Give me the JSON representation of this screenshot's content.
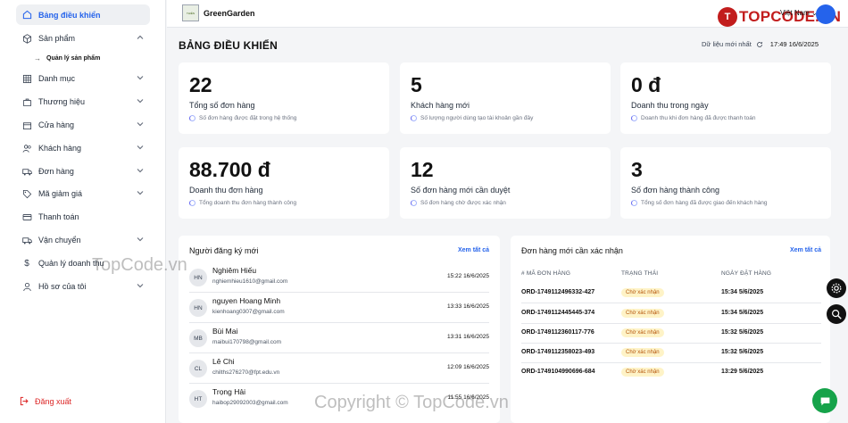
{
  "sidebar": {
    "items": [
      {
        "label": "Bảng điều khiển",
        "icon": "home-icon"
      },
      {
        "label": "Sản phẩm",
        "icon": "box-icon"
      },
      {
        "label": "Danh mục",
        "icon": "grid-icon"
      },
      {
        "label": "Thương hiệu",
        "icon": "briefcase-icon"
      },
      {
        "label": "Cửa hàng",
        "icon": "store-icon"
      },
      {
        "label": "Khách hàng",
        "icon": "users-icon"
      },
      {
        "label": "Đơn hàng",
        "icon": "truck-icon"
      },
      {
        "label": "Mã giảm giá",
        "icon": "tag-icon"
      },
      {
        "label": "Thanh toán",
        "icon": "card-icon"
      },
      {
        "label": "Vận chuyển",
        "icon": "shipping-icon"
      },
      {
        "label": "Quản lý doanh thu",
        "icon": "dollar-icon"
      },
      {
        "label": "Hồ sơ của tôi",
        "icon": "user-icon"
      }
    ],
    "subitem": "Quản lý sản phẩm",
    "logout": "Đăng xuất"
  },
  "topbar": {
    "brand": "GreenGarden",
    "brand_logo_text": "THIÊN",
    "watermark_logo": "TOPCODE.VN",
    "language": "Việt Nam"
  },
  "header": {
    "title": "BẢNG ĐIỀU KHIỂN",
    "refresh_label": "Dữ liệu mới nhất",
    "timestamp": "17:49 16/6/2025"
  },
  "stats": [
    {
      "value": "22",
      "label": "Tổng số đơn hàng",
      "desc": "Số đơn hàng được đặt trong hệ thống"
    },
    {
      "value": "5",
      "label": "Khách hàng mới",
      "desc": "Số lượng người dùng tạo tài khoản gần đây"
    },
    {
      "value": "0 đ",
      "label": "Doanh thu trong ngày",
      "desc": "Doanh thu khi đơn hàng đã được thanh toán"
    },
    {
      "value": "88.700 đ",
      "label": "Doanh thu đơn hàng",
      "desc": "Tổng doanh thu đơn hàng thành công"
    },
    {
      "value": "12",
      "label": "Số đơn hàng mới cần duyệt",
      "desc": "Số đơn hàng chờ được xác nhận"
    },
    {
      "value": "3",
      "label": "Số đơn hàng thành công",
      "desc": "Tổng số đơn hàng đã được giao đến khách hàng"
    }
  ],
  "new_users": {
    "title": "Người đăng ký mới",
    "see_all": "Xem tất cả",
    "rows": [
      {
        "initials": "HN",
        "name": "Nghiêm Hiếu",
        "email": "nghiemhieu1610@gmail.com",
        "time": "15:22 16/6/2025"
      },
      {
        "initials": "HN",
        "name": "nguyen Hoang Minh",
        "email": "kienhoang0307@gmail.com",
        "time": "13:33 16/6/2025"
      },
      {
        "initials": "MB",
        "name": "Bùi Mai",
        "email": "maibui170798@gmail.com",
        "time": "13:31 16/6/2025"
      },
      {
        "initials": "CL",
        "name": "Lê Chi",
        "email": "chilths276270@fpt.edu.vn",
        "time": "12:09 16/6/2025"
      },
      {
        "initials": "HT",
        "name": "Trọng Hải",
        "email": "haibop29092003@gmail.com",
        "time": "11:55 16/6/2025"
      }
    ]
  },
  "new_orders": {
    "title": "Đơn hàng mới cần xác nhận",
    "see_all": "Xem tất cả",
    "headers": [
      "# MÃ ĐƠN HÀNG",
      "TRẠNG THÁI",
      "NGÀY ĐẶT HÀNG"
    ],
    "rows": [
      {
        "code": "ORD-1749112496332-427",
        "status": "Chờ xác nhận",
        "date": "15:34 5/6/2025"
      },
      {
        "code": "ORD-1749112445445-374",
        "status": "Chờ xác nhận",
        "date": "15:34 5/6/2025"
      },
      {
        "code": "ORD-1749112360117-776",
        "status": "Chờ xác nhận",
        "date": "15:32 5/6/2025"
      },
      {
        "code": "ORD-1749112358023-493",
        "status": "Chờ xác nhận",
        "date": "15:32 5/6/2025"
      },
      {
        "code": "ORD-1749104990696-684",
        "status": "Chờ xác nhận",
        "date": "13:29 5/6/2025"
      }
    ]
  },
  "watermarks": {
    "mid": "TopCode.vn",
    "bottom": "Copyright © TopCode.vn"
  },
  "colors": {
    "accent": "#2563eb",
    "danger": "#dc2626",
    "badge_bg": "#fef3c7",
    "badge_text": "#b45309",
    "chat": "#16a34a",
    "watermark": "#c21d1d"
  }
}
